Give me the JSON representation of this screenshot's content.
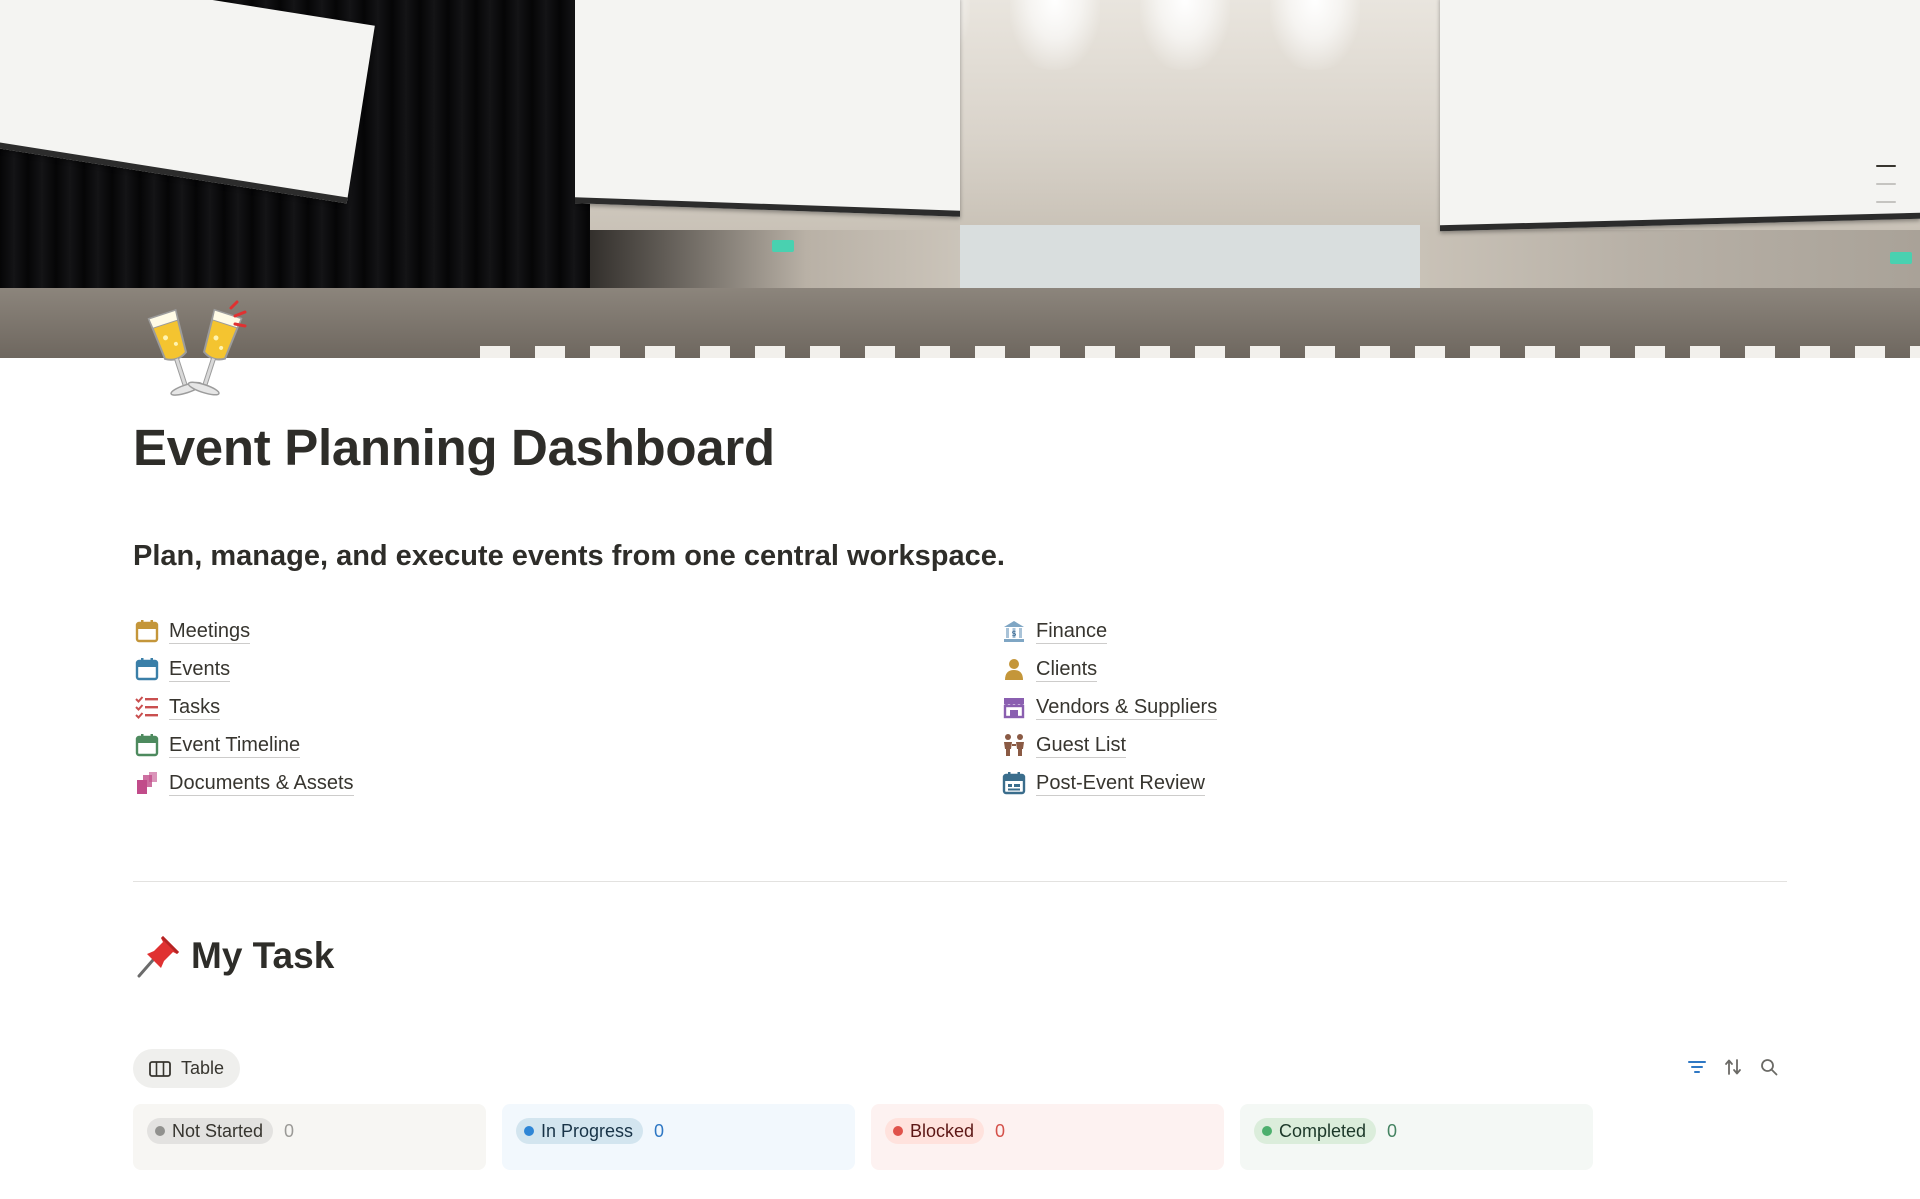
{
  "page": {
    "title": "Event Planning Dashboard",
    "subtitle": "Plan, manage, and execute events from one central workspace."
  },
  "links": {
    "left": [
      {
        "label": "Meetings",
        "icon": "calendar-icon",
        "color": "#c4963a"
      },
      {
        "label": "Events",
        "icon": "calendar-icon",
        "color": "#3a7fa8"
      },
      {
        "label": "Tasks",
        "icon": "checklist-icon",
        "color": "#c94f4f"
      },
      {
        "label": "Event Timeline",
        "icon": "calendar-icon",
        "color": "#4d8a5e"
      },
      {
        "label": "Documents & Assets",
        "icon": "documents-icon",
        "color": "#c14c8a"
      }
    ],
    "right": [
      {
        "label": "Finance",
        "icon": "bank-icon",
        "color": "#3a7fa8"
      },
      {
        "label": "Clients",
        "icon": "person-icon",
        "color": "#c4963a"
      },
      {
        "label": "Vendors & Suppliers",
        "icon": "storefront-icon",
        "color": "#8a5fb0"
      },
      {
        "label": "Guest List",
        "icon": "people-icon",
        "color": "#8a5a44"
      },
      {
        "label": "Post-Event Review",
        "icon": "calendar-icon",
        "color": "#3a6d8c"
      }
    ]
  },
  "section": {
    "title": "My Task",
    "icon": "pushpin-icon"
  },
  "view": {
    "tab_label": "Table",
    "tab_icon": "table-icon"
  },
  "toolbar": {
    "filter_icon": "filter-icon",
    "sort_icon": "sort-icon",
    "search_icon": "search-icon",
    "accent": "#2f78c4"
  },
  "board": [
    {
      "label": "Not Started",
      "count": "0",
      "bg": "#f7f6f3",
      "pill_bg": "#e3e2e0",
      "dot": "#91918e",
      "text": "#37352f",
      "count_color": "#9b9a97"
    },
    {
      "label": "In Progress",
      "count": "0",
      "bg": "#f2f8fd",
      "pill_bg": "#d3e5ef",
      "dot": "#2f86d6",
      "text": "#183347",
      "count_color": "#2f78c4"
    },
    {
      "label": "Blocked",
      "count": "0",
      "bg": "#fdf2f1",
      "pill_bg": "#ffe2dd",
      "dot": "#e0524a",
      "text": "#5d1715",
      "count_color": "#d4514a"
    },
    {
      "label": "Completed",
      "count": "0",
      "bg": "#f4f8f5",
      "pill_bg": "#dbeddb",
      "dot": "#4caf6d",
      "text": "#1c3829",
      "count_color": "#448361"
    }
  ]
}
